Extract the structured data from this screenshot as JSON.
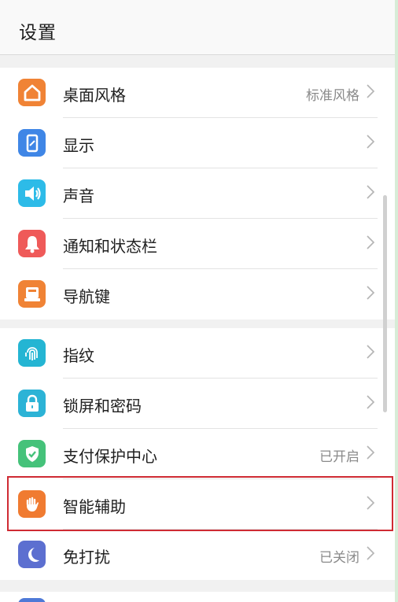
{
  "header": {
    "title": "设置"
  },
  "settings": {
    "rows": [
      {
        "label": "桌面风格",
        "value": "标准风格",
        "icon": "home-icon",
        "color": "#f08335"
      },
      {
        "label": "显示",
        "value": "",
        "icon": "phone-display-icon",
        "color": "#3f86e6"
      },
      {
        "label": "声音",
        "value": "",
        "icon": "speaker-icon",
        "color": "#2dbbe8"
      },
      {
        "label": "通知和状态栏",
        "value": "",
        "icon": "bell-icon",
        "color": "#ef5a59"
      },
      {
        "label": "导航键",
        "value": "",
        "icon": "navigation-keys-icon",
        "color": "#f08335"
      },
      {
        "label": "指纹",
        "value": "",
        "icon": "fingerprint-icon",
        "color": "#24b5d3"
      },
      {
        "label": "锁屏和密码",
        "value": "",
        "icon": "lock-icon",
        "color": "#2cb3d6"
      },
      {
        "label": "支付保护中心",
        "value": "已开启",
        "icon": "shield-check-icon",
        "color": "#45c27a"
      },
      {
        "label": "智能辅助",
        "value": "",
        "icon": "hand-icon",
        "color": "#f07b31"
      },
      {
        "label": "免打扰",
        "value": "已关闭",
        "icon": "moon-icon",
        "color": "#5c6fd0"
      }
    ]
  }
}
